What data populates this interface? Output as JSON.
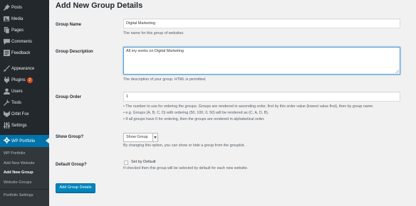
{
  "sidebar": {
    "items": [
      {
        "label": "Posts",
        "icon": "pin-icon"
      },
      {
        "label": "Media",
        "icon": "media-icon"
      },
      {
        "label": "Pages",
        "icon": "pages-icon"
      },
      {
        "label": "Comments",
        "icon": "comments-icon"
      },
      {
        "label": "Feedback",
        "icon": "feedback-icon"
      },
      {
        "label": "Appearance",
        "icon": "appearance-icon"
      },
      {
        "label": "Plugins",
        "icon": "plugins-icon",
        "count": "2"
      },
      {
        "label": "Users",
        "icon": "users-icon"
      },
      {
        "label": "Tools",
        "icon": "tools-icon"
      },
      {
        "label": "Orbit Fox",
        "icon": "orbitfox-icon"
      },
      {
        "label": "Settings",
        "icon": "settings-icon"
      },
      {
        "label": "WP Portfolio",
        "icon": "gear-icon"
      }
    ],
    "submenu": [
      {
        "label": "WP Portfolio"
      },
      {
        "label": "Add New Website"
      },
      {
        "label": "Add New Group"
      },
      {
        "label": "Website Groups"
      },
      {
        "label": "Portfolio Settings"
      }
    ]
  },
  "main": {
    "title": "Add New Group Details",
    "fields": {
      "name": {
        "label": "Group Name",
        "value": "Digital Marketing",
        "help": "The name for this group of websites."
      },
      "description": {
        "label": "Group Description",
        "value": "All my works on Digital Marketing",
        "help": "The description of your group. HTML is permitted."
      },
      "order": {
        "label": "Group Order",
        "value": "1",
        "help": [
          "• The number to use for ordering the groups. Groups are rendered in ascending order, first by this order value (lowest value first), then by group name.",
          "• e.g. Groups (A, B, C, D) with ordering (50, 100, 0, 50) will be rendered as (C, A, D, B).",
          "• If all groups have 0 for ordering, then the groups are rendered in alphabetical order."
        ]
      },
      "show": {
        "label": "Show Group?",
        "selected": "Show Group",
        "help": "By changing this option, you can show or hide a group from the grouplist."
      },
      "default": {
        "label": "Default Group?",
        "checkbox_label": "Set by Default",
        "checked": false,
        "help": "If checked then this group will be selected by default for each new website."
      }
    },
    "submit_label": "Add Group Details"
  },
  "colors": {
    "sidebar_bg": "#23282d",
    "submenu_bg": "#32373c",
    "accent": "#0073aa",
    "button": "#0085ba",
    "badge": "#d54e21"
  }
}
